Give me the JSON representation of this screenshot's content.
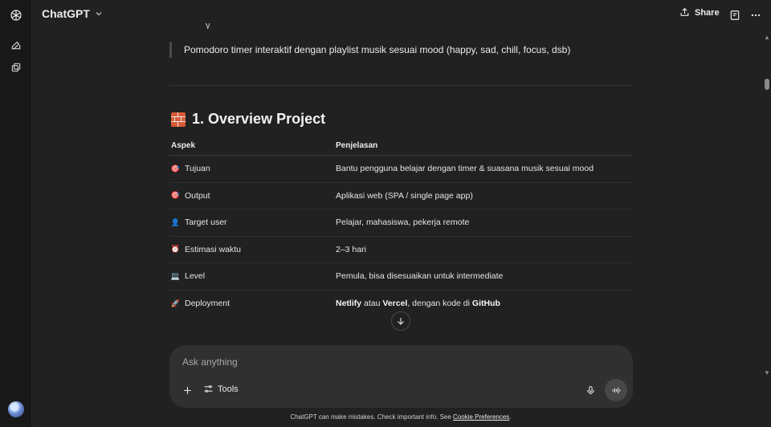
{
  "app": {
    "title": "ChatGPT"
  },
  "header": {
    "share_label": "Share"
  },
  "content": {
    "quote": "Pomodoro timer interaktif dengan playlist musik sesuai mood (happy, sad, chill, focus, dsb)",
    "heading": "1. Overview Project",
    "table": {
      "headers": [
        "Aspek",
        "Penjelasan"
      ],
      "rows": [
        {
          "icon": "target-icon",
          "aspect": "Tujuan",
          "value": "Bantu pengguna belajar dengan timer & suasana musik sesuai mood"
        },
        {
          "icon": "target-icon",
          "aspect": "Output",
          "value": "Aplikasi web (SPA / single page app)"
        },
        {
          "icon": "user-icon",
          "aspect": "Target user",
          "value": "Pelajar, mahasiswa, pekerja remote"
        },
        {
          "icon": "alarm-clock-icon",
          "aspect": "Estimasi waktu",
          "value": "2–3 hari"
        },
        {
          "icon": "technologist-icon",
          "aspect": "Level",
          "value": "Pemula, bisa disesuaikan untuk intermediate"
        },
        {
          "icon": "rocket-icon",
          "aspect": "Deployment",
          "value_parts": {
            "p1": "Netlify",
            "p2": " atau ",
            "p3": "Vercel",
            "p4": ", dengan kode di ",
            "p5": "GitHub"
          }
        }
      ]
    }
  },
  "composer": {
    "placeholder": "Ask anything",
    "tools_label": "Tools"
  },
  "footer": {
    "text": "ChatGPT can make mistakes. Check important info. See ",
    "link": "Cookie Preferences",
    "end": "."
  },
  "colors": {
    "background": "#212121",
    "sidebar": "#181818",
    "composer": "#303030",
    "text": "#ececec"
  }
}
